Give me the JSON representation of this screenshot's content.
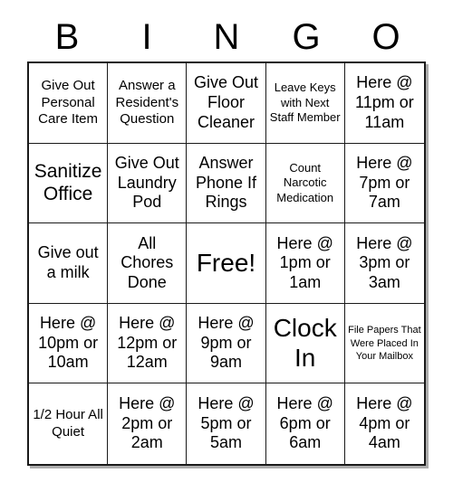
{
  "header": {
    "letters": [
      "B",
      "I",
      "N",
      "G",
      "O"
    ]
  },
  "grid": {
    "columns": 5,
    "rows": 5,
    "cells": [
      {
        "text": "Give Out Personal Care Item",
        "size": "sz-md"
      },
      {
        "text": "Answer a Resident's Question",
        "size": "sz-md"
      },
      {
        "text": "Give Out Floor Cleaner",
        "size": "sz-lg"
      },
      {
        "text": "Leave Keys with Next Staff Member",
        "size": "sz-sm"
      },
      {
        "text": "Here @ 11pm or 11am",
        "size": "sz-lg"
      },
      {
        "text": "Sanitize Office",
        "size": "sz-xl"
      },
      {
        "text": "Give Out Laundry Pod",
        "size": "sz-lg"
      },
      {
        "text": "Answer Phone If Rings",
        "size": "sz-lg"
      },
      {
        "text": "Count Narcotic Medication",
        "size": "sz-sm"
      },
      {
        "text": "Here @ 7pm or 7am",
        "size": "sz-lg"
      },
      {
        "text": "Give out a milk",
        "size": "sz-lg"
      },
      {
        "text": "All Chores Done",
        "size": "sz-lg"
      },
      {
        "text": "Free!",
        "size": "sz-xxl"
      },
      {
        "text": "Here @ 1pm or 1am",
        "size": "sz-lg"
      },
      {
        "text": "Here @ 3pm or 3am",
        "size": "sz-lg"
      },
      {
        "text": "Here @ 10pm or 10am",
        "size": "sz-lg"
      },
      {
        "text": "Here @ 12pm or 12am",
        "size": "sz-lg"
      },
      {
        "text": "Here @ 9pm or 9am",
        "size": "sz-lg"
      },
      {
        "text": "Clock In",
        "size": "sz-xxl"
      },
      {
        "text": "File Papers That Were Placed In Your Mailbox",
        "size": "sz-xs"
      },
      {
        "text": "1/2 Hour All Quiet",
        "size": "sz-md"
      },
      {
        "text": "Here @ 2pm or 2am",
        "size": "sz-lg"
      },
      {
        "text": "Here @ 5pm or 5am",
        "size": "sz-lg"
      },
      {
        "text": "Here @ 6pm or 6am",
        "size": "sz-lg"
      },
      {
        "text": "Here @ 4pm or 4am",
        "size": "sz-lg"
      }
    ]
  },
  "colors": {
    "background": "#ffffff",
    "border": "#1a1a1a",
    "text": "#000000"
  }
}
